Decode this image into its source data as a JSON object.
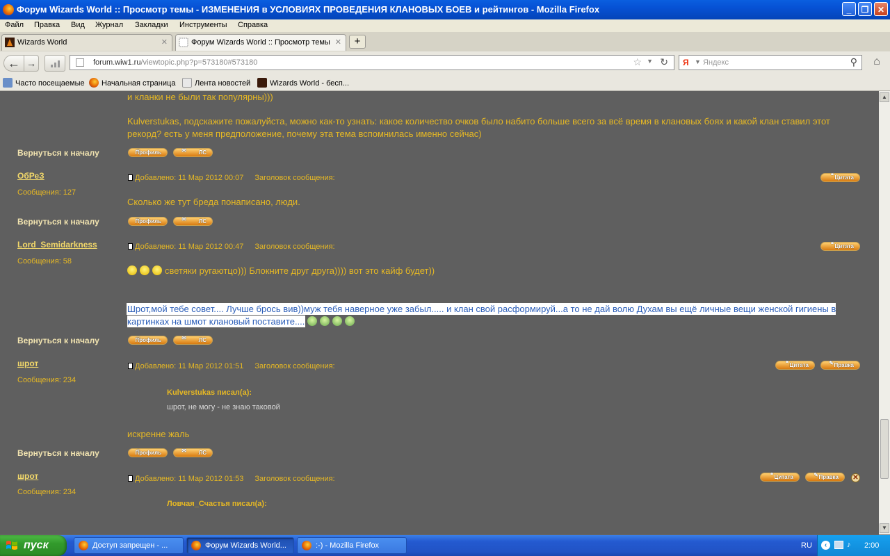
{
  "window": {
    "title": "Форум Wizards World :: Просмотр темы - ИЗМЕНЕНИЯ в УСЛОВИЯХ ПРОВЕДЕНИЯ КЛАНОВЫХ БОЕВ и рейтингов - Mozilla Firefox",
    "minimize": "_",
    "maximize": "❐",
    "close": "✕"
  },
  "menu": [
    "Файл",
    "Правка",
    "Вид",
    "Журнал",
    "Закладки",
    "Инструменты",
    "Справка"
  ],
  "tabs": [
    {
      "label": "Wizards World",
      "close": "✕"
    },
    {
      "label": "Форум Wizards World :: Просмотр темы ...",
      "close": "✕"
    }
  ],
  "newtab_label": "+",
  "nav": {
    "back": "←",
    "forward": "→",
    "url_host": "forum.wiw1.ru",
    "url_path": "/viewtopic.php?p=573180#573180",
    "search_placeholder": "Яндекс",
    "search_engine": "Я",
    "star": "☆",
    "reload": "↻",
    "dropdown": "▼",
    "search_btn": "⚲",
    "home": "⌂"
  },
  "bookmarks": [
    "Часто посещаемые",
    "Начальная страница",
    "Лента новостей",
    "Wizards World - бесп..."
  ],
  "page": {
    "back_to_top": "Вернуться к началу",
    "added_prefix": "Добавлено:",
    "subject_label": "Заголовок сообщения:",
    "btn_profile": "Профиль",
    "btn_pm": "ЛС",
    "btn_quote": "Цитата",
    "btn_edit": "Правка",
    "top_text_line1": "и кланки не были так популярны)))",
    "top_text_p": "Kulverstukas, подскажите пожалуйста, можно как-то узнать: какое количество очков было набито больше всего за всё время в клановых боях и какой клан ставил этот рекорд? есть у меня предположение, почему эта тема вспомнилась именно сейчас)",
    "posts": [
      {
        "author": "ОбРеЗ",
        "count": "Сообщения: 127",
        "date": "11 Мар 2012 00:07",
        "text": "Сколько же тут бреда понаписано, люди."
      },
      {
        "author": "Lord_Semidarkness",
        "count": "Сообщения: 58",
        "date": "11 Мар 2012 00:47",
        "text": "светяки ругаютцо))) Блокните друг друга)))) вот это кайф будет))",
        "selected": "Шрот,мой тебе совет.... Лучше брось вив))муж тебя наверное уже забыл..... и клан свой расформируй...а то не дай волю Духам вы ещё личные вещи женской гигиены в картинках на шмот клановый поставите...."
      },
      {
        "author": "шрот",
        "count": "Сообщения: 234",
        "date": "11 Мар 2012 01:51",
        "quote_author": "Kulverstukas писал(а):",
        "quote_text": "шрот, не могу - не знаю таковой",
        "text": "искренне жаль"
      },
      {
        "author": "шрот",
        "count": "Сообщения: 234",
        "date": "11 Мар 2012 01:53",
        "quote_author": "Ловчая_Счастья писал(а):"
      }
    ]
  },
  "taskbar": {
    "start": "пуск",
    "tasks": [
      "Доступ запрещен - ...",
      "Форум Wizards World...",
      ":-) - Mozilla Firefox"
    ],
    "lang": "RU",
    "time": "2:00"
  },
  "colors": {
    "page_bg": "#5f5f5f",
    "post_text": "#e6b824",
    "selected_text": "#2a5db8"
  }
}
